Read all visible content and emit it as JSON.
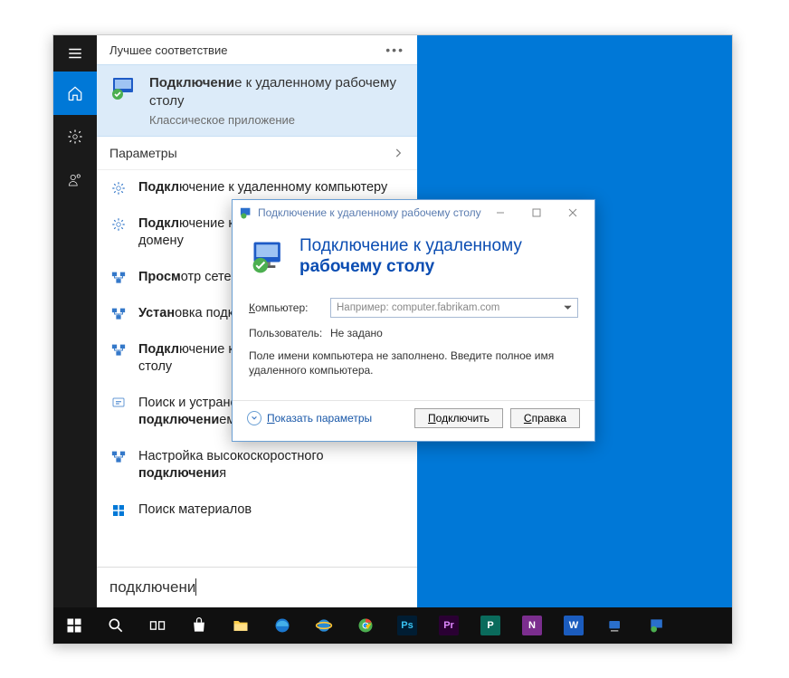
{
  "colors": {
    "accent": "#0078d7",
    "link": "#1857a8",
    "taskbar": "#101010"
  },
  "start": {
    "header": "Лучшее соответствие",
    "top": {
      "title_prefix": "Подключени",
      "title_suffix": "е к удаленному рабочему столу",
      "subtitle": "Классическое приложение"
    },
    "params_label": "Параметры",
    "items": [
      {
        "prefix": "Подкл",
        "suffix": "ючение к удаленному компьютеру"
      },
      {
        "prefix": "Подкл",
        "suffix": "ючение к рабочему месту или домену"
      },
      {
        "prefix": "Просм",
        "suffix": "отр сетевых подключений"
      },
      {
        "prefix": "Устан",
        "suffix": "овка подключения"
      },
      {
        "prefix": "Подкл",
        "suffix": "ючение к удаленному рабочему столу"
      },
      {
        "prefix": "Поиск и устранение проблем с сетью и ",
        "bold": "подключени",
        "suffix": "ем"
      },
      {
        "prefix": "Настройка высокоскоростного ",
        "bold": "подключени",
        "suffix": "я"
      }
    ],
    "store_label": "Поиск материалов",
    "search_value": "подключени"
  },
  "rdc": {
    "title": "Подключение к удаленному рабочему столу",
    "banner_line1": "Подключение к удаленному",
    "banner_line2": "рабочему столу",
    "computer_label": "Компьютер:",
    "computer_placeholder": "Например: computer.fabrikam.com",
    "user_label": "Пользователь:",
    "user_value": "Не задано",
    "hint": "Поле имени компьютера не заполнено. Введите полное имя удаленного компьютера.",
    "show_params": "Показать параметры",
    "connect": "Подключить",
    "help": "Справка"
  },
  "taskbar_apps": [
    "start",
    "search",
    "taskview",
    "store",
    "explorer",
    "edge",
    "ie",
    "chrome",
    "ps",
    "pr",
    "word_pub",
    "onenote",
    "word",
    "network",
    "rdc"
  ]
}
